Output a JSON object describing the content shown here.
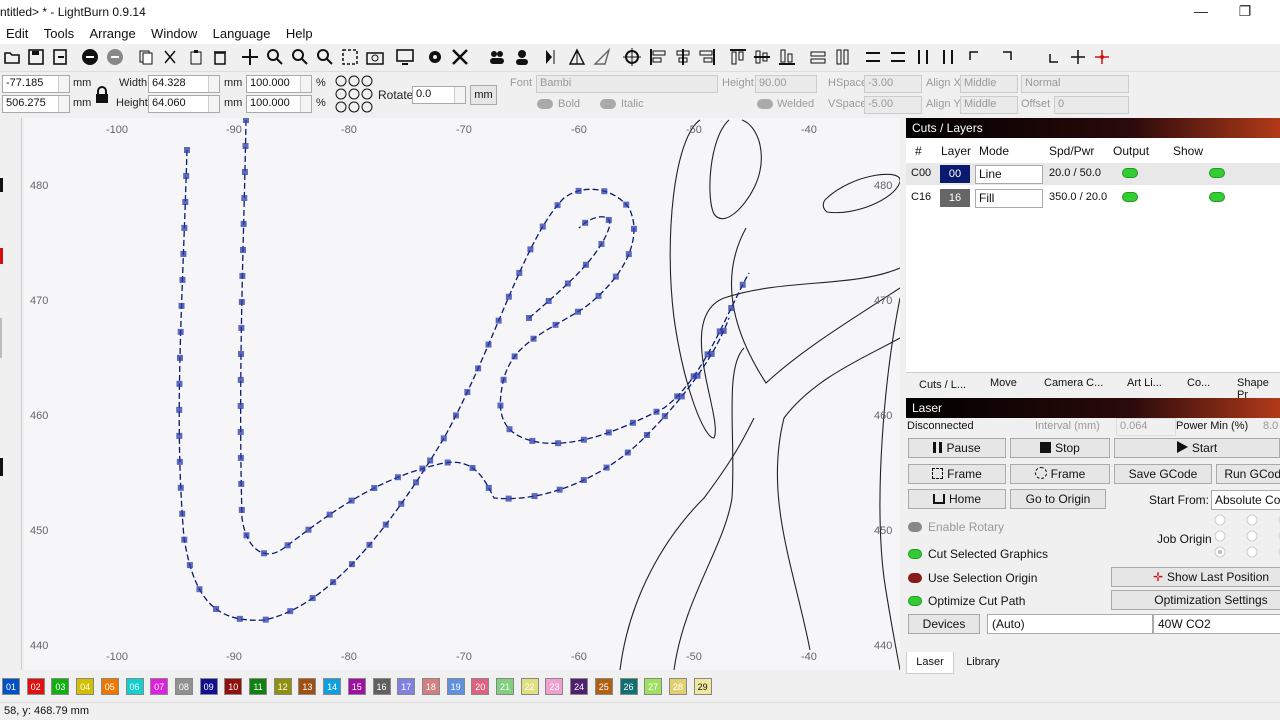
{
  "window": {
    "title": "ntitled> * - LightBurn 0.9.14",
    "min": "—",
    "max": "❐"
  },
  "menu": [
    "Edit",
    "Tools",
    "Arrange",
    "Window",
    "Language",
    "Help"
  ],
  "props": {
    "x_value": "-77.185",
    "y_value": "506.275",
    "unit_mm": "mm",
    "width_label": "Width",
    "width_value": "64.328",
    "height_label": "Height",
    "height_value": "64.060",
    "w_pct": "100.000",
    "h_pct": "100.000",
    "pct": "%",
    "rotate_label": "Rotate",
    "rotate_value": "0.0",
    "mm_button": "mm",
    "font_label": "Font",
    "font_value": "Bambi",
    "bold_label": "Bold",
    "italic_label": "Italic",
    "fheight_label": "Height",
    "fheight_value": "90.00",
    "welded_label": "Welded",
    "hspace_label": "HSpace",
    "hspace_value": "-3.00",
    "vspace_label": "VSpace",
    "vspace_value": "-5.00",
    "alignx_label": "Align X",
    "alignx_value": "Middle",
    "aligny_label": "Align Y",
    "aligny_value": "Middle",
    "normal_value": "Normal",
    "offset_label": "Offset",
    "offset_value": "0"
  },
  "ruler": {
    "x_top": [
      "-100",
      "-90",
      "-80",
      "-70",
      "-60",
      "-50",
      "-40"
    ],
    "y_left": [
      "480",
      "470",
      "460",
      "450",
      "440"
    ],
    "y_right": [
      "480",
      "470",
      "460",
      "450",
      "440"
    ]
  },
  "cuts": {
    "title": "Cuts / Layers",
    "headers": [
      "#",
      "Layer",
      "Mode",
      "Spd/Pwr",
      "Output",
      "Show"
    ],
    "rows": [
      {
        "num": "C00",
        "layer": "00",
        "mode": "Line",
        "spdpwr": "20.0 / 50.0",
        "color": "#0a1a6e"
      },
      {
        "num": "C16",
        "layer": "16",
        "mode": "Fill",
        "spdpwr": "350.0 / 20.0",
        "color": "#666666"
      }
    ],
    "tabs": [
      "Cuts / L...",
      "Move",
      "Camera C...",
      "Art Li...",
      "Co...",
      "Shape Pr"
    ]
  },
  "laser": {
    "title": "Laser",
    "status": "Disconnected",
    "interval_label": "Interval (mm)",
    "interval_value": "0.064",
    "powermin_label": "Power Min (%)",
    "powermin_value": "8.0",
    "pause": "Pause",
    "stop": "Stop",
    "start": "Start",
    "frame1": "Frame",
    "frame2": "Frame",
    "save_gcode": "Save GCode",
    "run_gcode": "Run GCode",
    "home": "Home",
    "go_origin": "Go to Origin",
    "start_from_label": "Start From:",
    "start_from_value": "Absolute Coords",
    "enable_rotary": "Enable Rotary",
    "job_origin": "Job Origin",
    "cut_selected": "Cut Selected Graphics",
    "use_sel_origin": "Use Selection Origin",
    "show_last": "Show Last Position",
    "optimize": "Optimize Cut Path",
    "opt_settings": "Optimization Settings",
    "devices": "Devices",
    "device_value": "(Auto)",
    "machine": "40W CO2"
  },
  "bottom_tabs": [
    "Laser",
    "Library"
  ],
  "palette": [
    {
      "n": "01",
      "c": "#0050c8"
    },
    {
      "n": "02",
      "c": "#e01010"
    },
    {
      "n": "03",
      "c": "#10b010"
    },
    {
      "n": "04",
      "c": "#d0c000"
    },
    {
      "n": "05",
      "c": "#f07800"
    },
    {
      "n": "06",
      "c": "#10d0d0"
    },
    {
      "n": "07",
      "c": "#e020e0"
    },
    {
      "n": "08",
      "c": "#909090"
    },
    {
      "n": "09",
      "c": "#101090"
    },
    {
      "n": "10",
      "c": "#901010"
    },
    {
      "n": "11",
      "c": "#108010"
    },
    {
      "n": "12",
      "c": "#909010"
    },
    {
      "n": "13",
      "c": "#a05010"
    },
    {
      "n": "14",
      "c": "#10a0e0"
    },
    {
      "n": "15",
      "c": "#a010a0"
    },
    {
      "n": "16",
      "c": "#606060"
    },
    {
      "n": "17",
      "c": "#8080e0"
    },
    {
      "n": "18",
      "c": "#d08080"
    },
    {
      "n": "19",
      "c": "#6090e0"
    },
    {
      "n": "20",
      "c": "#e06080"
    },
    {
      "n": "21",
      "c": "#80d080"
    },
    {
      "n": "22",
      "c": "#e0e080"
    },
    {
      "n": "23",
      "c": "#f0a0d0"
    },
    {
      "n": "24",
      "c": "#502070"
    },
    {
      "n": "25",
      "c": "#b06010"
    },
    {
      "n": "26",
      "c": "#107070"
    },
    {
      "n": "27",
      "c": "#a0e060"
    },
    {
      "n": "28",
      "c": "#e0d070"
    }
  ],
  "palette_last": "29",
  "status": {
    "coords": "58, y: 468.79 mm"
  }
}
